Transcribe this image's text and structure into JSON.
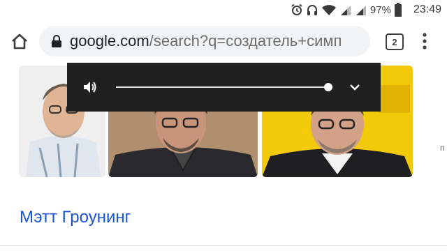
{
  "status_bar": {
    "battery_percent": "97%",
    "time": "23:49",
    "icons": [
      "alarm-icon",
      "headphones-icon",
      "wifi-icon",
      "signal-icon",
      "signal-icon",
      "battery-icon"
    ]
  },
  "toolbar": {
    "url_host": "google.com",
    "url_path": "/search?q=создатель+симп",
    "tab_count": "2",
    "icons": [
      "home-icon",
      "lock-icon",
      "menu-dots-icon"
    ]
  },
  "volume_overlay": {
    "level": 0.999,
    "icons": [
      "volume-icon",
      "chevron-down-icon"
    ]
  },
  "result": {
    "title": "Мэтт Гроунинг"
  },
  "colors": {
    "link": "#1a55d3",
    "overlay_bg": "#202020"
  }
}
